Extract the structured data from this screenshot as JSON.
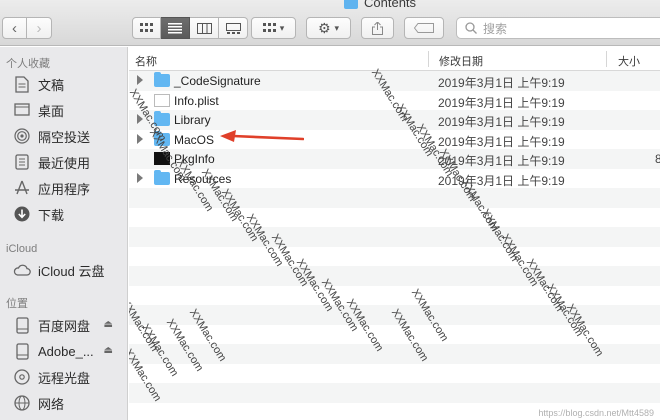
{
  "window": {
    "title": "Contents"
  },
  "toolbar": {
    "back_label": "‹",
    "forward_label": "›",
    "search_placeholder": "搜索"
  },
  "sidebar": {
    "favorites_header": "个人收藏",
    "favorites": [
      {
        "label": "文稿",
        "icon": "document-icon"
      },
      {
        "label": "桌面",
        "icon": "desktop-icon"
      },
      {
        "label": "隔空投送",
        "icon": "airdrop-icon"
      },
      {
        "label": "最近使用",
        "icon": "recents-icon"
      },
      {
        "label": "应用程序",
        "icon": "applications-icon"
      },
      {
        "label": "下载",
        "icon": "download-icon"
      }
    ],
    "icloud_header": "iCloud",
    "icloud": [
      {
        "label": "iCloud 云盘",
        "icon": "cloud-icon"
      }
    ],
    "locations_header": "位置",
    "locations": [
      {
        "label": "百度网盘",
        "icon": "disk-icon",
        "eject": "⏏"
      },
      {
        "label": "Adobe_...",
        "icon": "disk-icon",
        "eject": "⏏"
      },
      {
        "label": "远程光盘",
        "icon": "optical-disc-icon"
      },
      {
        "label": "网络",
        "icon": "network-icon"
      }
    ]
  },
  "columns": {
    "name": "名称",
    "modified": "修改日期",
    "size": "大小"
  },
  "files": [
    {
      "name": "_CodeSignature",
      "date": "2019年3月1日 上午9:19",
      "size": "",
      "kind": "folder",
      "expandable": true
    },
    {
      "name": "Info.plist",
      "date": "2019年3月1日 上午9:19",
      "size": "",
      "kind": "document",
      "expandable": false
    },
    {
      "name": "Library",
      "date": "2019年3月1日 上午9:19",
      "size": "",
      "kind": "folder",
      "expandable": true
    },
    {
      "name": "MacOS",
      "date": "2019年3月1日 上午9:19",
      "size": "",
      "kind": "folder",
      "expandable": true
    },
    {
      "name": "PkgInfo",
      "date": "2019年3月1日 上午9:19",
      "size": "8",
      "kind": "executable",
      "expandable": false
    },
    {
      "name": "Resources",
      "date": "2019年3月1日 上午9:19",
      "size": "",
      "kind": "folder",
      "expandable": true
    }
  ],
  "watermark": "XXMac.com",
  "credit": "https://blog.csdn.net/Mtt4589",
  "colors": {
    "folder": "#62b7f2",
    "arrow": "#e0402a",
    "sidebar_bg": "#e9e9eb"
  }
}
